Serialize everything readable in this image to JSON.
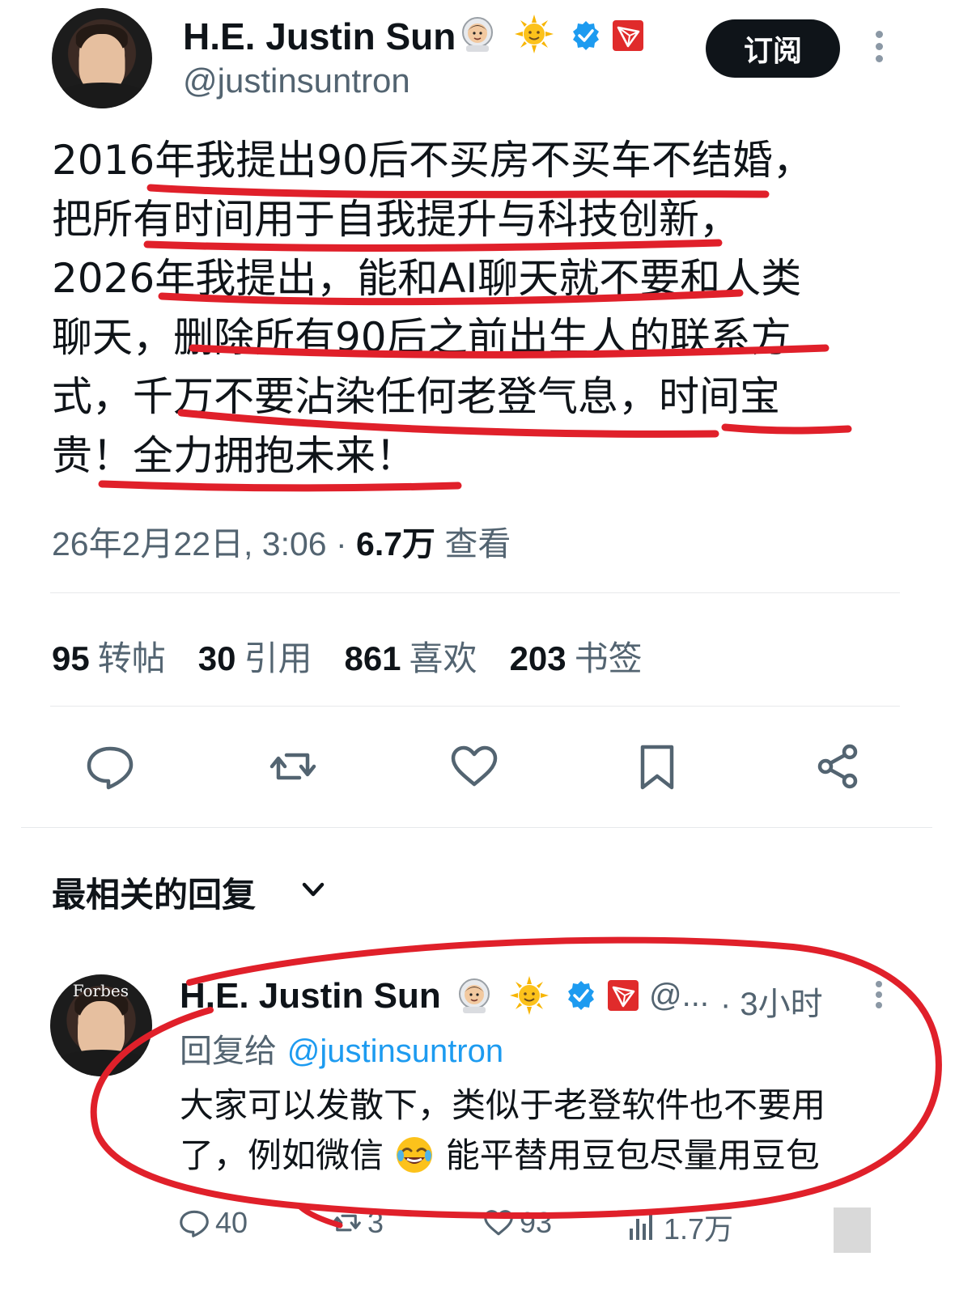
{
  "tweet": {
    "author_name": "H.E. Justin Sun",
    "author_handle": "@justinsuntron",
    "subscribe_label": "订阅",
    "text": "2016年我提出90后不买房不买车不结婚，\n把所有时间用于自我提升与科技创新，\n2026年我提出，能和AI聊天就不要和人类\n聊天，删除所有90后之前出生人的联系方\n式，千万不要沾染任何老登气息，时间宝\n贵！全力拥抱未来！",
    "timestamp": "26年2月22日, 3:06 · ",
    "views_count": "6.7万",
    "views_label": " 查看",
    "stats": {
      "reposts": {
        "count": "95",
        "label": "转帖"
      },
      "quotes": {
        "count": "30",
        "label": "引用"
      },
      "likes": {
        "count": "861",
        "label": "喜欢"
      },
      "bookmarks": {
        "count": "203",
        "label": "书签"
      }
    }
  },
  "replies_section": {
    "sort_label": "最相关的回复"
  },
  "reply": {
    "author_name": "H.E. Justin Sun",
    "handle_truncated": "@...",
    "time": "· 3小时",
    "reply_to_label": "回复给 ",
    "reply_to_mention": "@justinsuntron",
    "text_line1": "大家可以发散下，类似于老登软件也不要用",
    "text_line2_a": "了，例如微信 ",
    "text_line2_b": " 能平替用豆包尽量用豆包",
    "actions": {
      "replies": "40",
      "reposts": "3",
      "likes": "93",
      "views": "1.7万"
    }
  },
  "avatar_text": "Forbes",
  "icons": [
    "astronaut-emoji",
    "sun-emoji",
    "verified-badge-icon",
    "tron-logo-icon",
    "more-icon",
    "reply-icon",
    "repost-icon",
    "like-icon",
    "bookmark-icon",
    "share-icon",
    "chevron-down-icon",
    "laughing-emoji",
    "views-icon"
  ],
  "colors": {
    "text": "#0f1419",
    "secondary": "#536471",
    "link": "#1d9bf0",
    "verified": "#1d9bf0",
    "tron": "#e02b2b",
    "annotation": "#e0202a"
  }
}
